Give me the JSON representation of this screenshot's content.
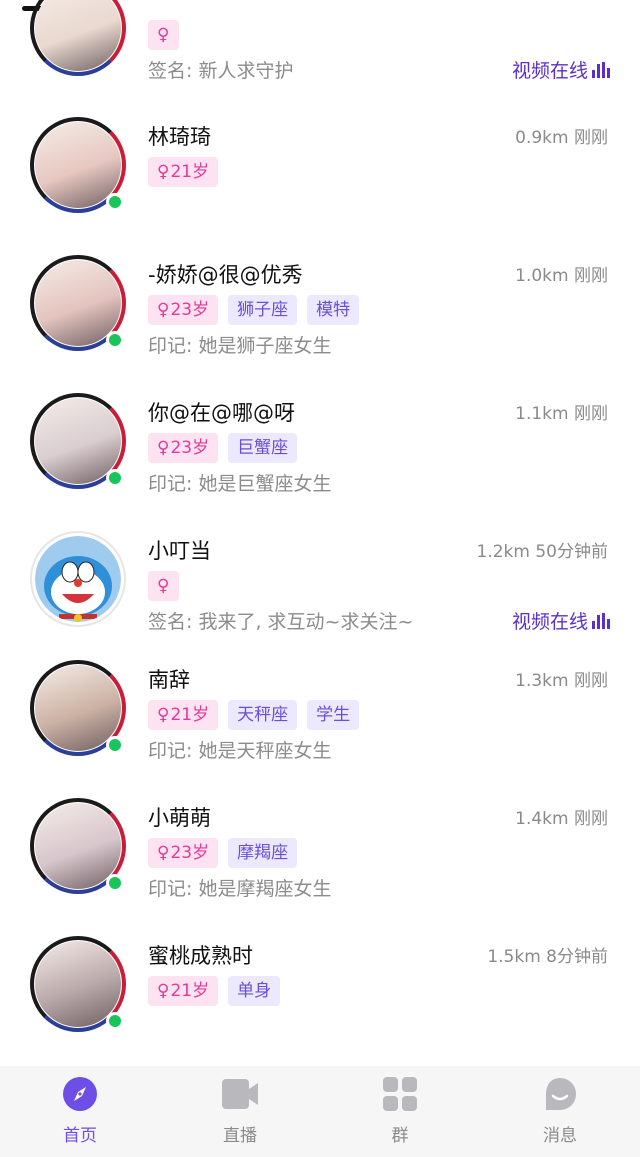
{
  "users": [
    {
      "name": "",
      "tags": [
        {
          "type": "gender",
          "text": ""
        }
      ],
      "meta": "",
      "signature": "签名: 新人求守护",
      "video": "视频在线",
      "online": false,
      "photo": "#e9d9cf"
    },
    {
      "name": "林琦琦",
      "tags": [
        {
          "type": "gender",
          "text": "21岁"
        }
      ],
      "meta": "0.9km 刚刚",
      "signature": "",
      "video": "",
      "online": true,
      "photo": "#e7c7c0"
    },
    {
      "name": "-娇娇@很@优秀",
      "tags": [
        {
          "type": "gender",
          "text": "23岁"
        },
        {
          "type": "attr",
          "text": "狮子座"
        },
        {
          "type": "attr",
          "text": "模特"
        }
      ],
      "meta": "1.0km 刚刚",
      "signature": "印记: 她是狮子座女生",
      "video": "",
      "online": true,
      "photo": "#e3c3bd"
    },
    {
      "name": "你@在@哪@呀",
      "tags": [
        {
          "type": "gender",
          "text": "23岁"
        },
        {
          "type": "attr",
          "text": "巨蟹座"
        }
      ],
      "meta": "1.1km 刚刚",
      "signature": "印记: 她是巨蟹座女生",
      "video": "",
      "online": true,
      "photo": "#d9cdd0"
    },
    {
      "name": "小叮当",
      "tags": [
        {
          "type": "gender",
          "text": ""
        }
      ],
      "meta": "1.2km 50分钟前",
      "signature": "签名: 我来了, 求互动~求关注~",
      "video": "视频在线",
      "online": false,
      "photo": "doraemon"
    },
    {
      "name": "南辞",
      "tags": [
        {
          "type": "gender",
          "text": "21岁"
        },
        {
          "type": "attr",
          "text": "天秤座"
        },
        {
          "type": "attr",
          "text": "学生"
        }
      ],
      "meta": "1.3km 刚刚",
      "signature": "印记: 她是天秤座女生",
      "video": "",
      "online": true,
      "photo": "#cbb2a3"
    },
    {
      "name": "小萌萌",
      "tags": [
        {
          "type": "gender",
          "text": "23岁"
        },
        {
          "type": "attr",
          "text": "摩羯座"
        }
      ],
      "meta": "1.4km 刚刚",
      "signature": "印记: 她是摩羯座女生",
      "video": "",
      "online": true,
      "photo": "#d7c6cc"
    },
    {
      "name": "蜜桃成熟时",
      "tags": [
        {
          "type": "gender",
          "text": "21岁"
        },
        {
          "type": "attr",
          "text": "单身"
        }
      ],
      "meta": "1.5km 8分钟前",
      "signature": "",
      "video": "",
      "online": true,
      "photo": "#b9a8a9"
    }
  ],
  "tabbar": {
    "home": "首页",
    "live": "直播",
    "group": "群",
    "messages": "消息",
    "active_color": "#6d4ee6"
  },
  "colors": {
    "gender_bg": "#fde3f1",
    "gender_fg": "#e23a98",
    "attr_bg": "#ece9ff",
    "attr_fg": "#6a4fd6",
    "video": "#5b2fc8",
    "online": "#19c45a"
  }
}
